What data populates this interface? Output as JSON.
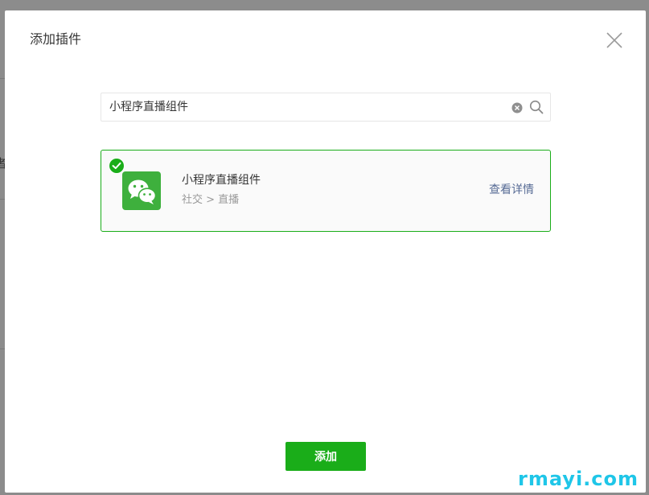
{
  "dialog": {
    "title": "添加插件",
    "close_icon": "close-icon"
  },
  "search": {
    "value": "小程序直播组件",
    "clear_icon": "clear-icon",
    "search_icon": "search-icon"
  },
  "result": {
    "selected": true,
    "logo_icon": "wechat-icon",
    "name": "小程序直播组件",
    "category": "社交 > 直播",
    "detail_label": "查看详情"
  },
  "actions": {
    "add_label": "添加"
  },
  "backdrop": {
    "partial_text": "者"
  },
  "watermark": "rmayi.com",
  "colors": {
    "accent": "#1aad19",
    "link": "#576b95",
    "watermark": "#1fc6e8"
  }
}
